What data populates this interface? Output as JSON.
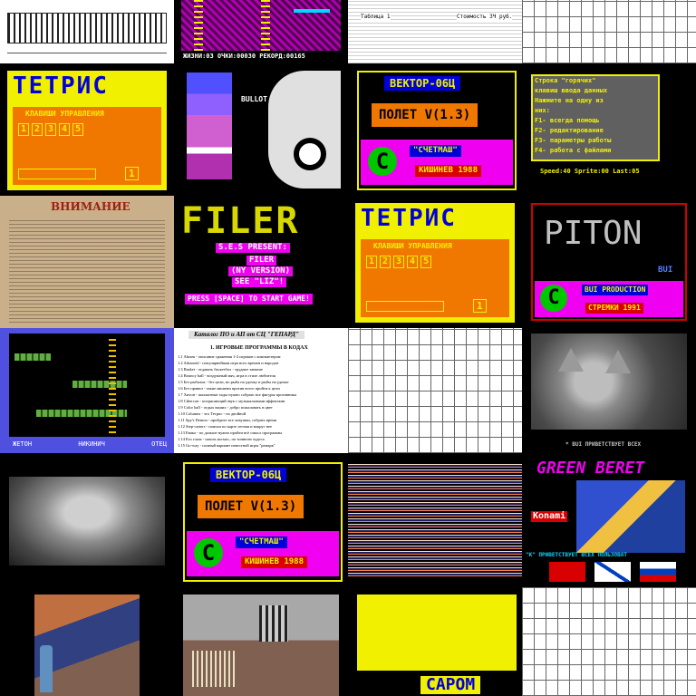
{
  "colors": {
    "black": "#000000",
    "yellow": "#f0f000",
    "orange": "#f07800",
    "blue": "#0000d8",
    "magenta": "#f000f0",
    "green": "#00c800",
    "cyan": "#00d8ff",
    "red": "#d80000"
  },
  "row1": {
    "t2_status": "ЖИЗНИ:03 ОЧКИ:00030 РЕКОРД:00165",
    "t3_heading": "Таблица 1",
    "t3_col": "Стоимость ЗЧ руб."
  },
  "tetris": {
    "title": "ТЕТРИС",
    "subtitle": "КЛАВИШИ УПРАВЛЕНИЯ",
    "keys": [
      "1",
      "2",
      "3",
      "4",
      "5"
    ],
    "center_key": "1"
  },
  "t6_label": "BULLOT",
  "vector": {
    "title": "ВЕКТОР-06Ц",
    "flight": "ПОЛЕТ V(1.3)",
    "logo": "C",
    "company": "\"СЧЕТМАШ\"",
    "city_year": "КИШИНЕВ 1988"
  },
  "t8": {
    "lines": [
      "Строка \"горячих\"",
      "клавиш ввода данных",
      "Нажмите на одну из",
      "них:",
      "F1- всегда помощь",
      "F2- редактирование",
      "F3- параметры работы",
      "F4- работа с файлами"
    ],
    "status": "Speed:40  Sprite:00  Last:05"
  },
  "t9_title": "ВНИМАНИЕ",
  "filer": {
    "title": "FILER",
    "presents": "S.E.S PRESENT:",
    "subtitle": "FILER",
    "version": "(NY VERSION)",
    "see": "SEE \"LIZ\"!",
    "prompt": "PRESS [SPACE] TO START GAME!"
  },
  "piton": {
    "title": "PITON",
    "sub": "BUI",
    "logo": "C",
    "production": "BUI PRODUCTION",
    "city_year": "СТРЕМКИ  1991"
  },
  "t13": {
    "status": [
      "ЖЕТОН",
      "НИКИНИЧ",
      "ОТЕЦ"
    ]
  },
  "catalog": {
    "title": "Каталог ПО и АП от СЦ \"ГЕПАРД\"",
    "section": "1. ИГРОВЫЕ ПРОГРАММЫ В КОДАХ",
    "items": [
      "1.1  Abram - описание сражения 1-2 игроков с компьютером",
      "1.2  Arkanoid - популярнейшая игра всех времен и народов",
      "1.3  Basket - отдавать баскетбол - трудное занятие",
      "1.4  Bouncy ball - воздушный мяч, игра в стиле любителя",
      "1.5  Без рыбалок - без цели, но рыба на удочку и рыбы на удочке",
      "1.6  Без правил - такие мишени против всего пройти к цели",
      "1.7  Хитон - шахматные ходы нужно собрать все фигуры противника",
      "1.8  Cibercon - потрясающий звук с музыкальными эффектами",
      "1.9  Color ball - отдых ваших - добро пожаловать в цвет",
      "1.10 Columns - это Тетрис - но двойной",
      "1.11 Spy's Demon - пройдите все ловушки, собрать время",
      "1.12 Step-carters - поиски по карте лесная и вокруг нее",
      "1.13 Евака - по дальше нужно пройти всё смысл программы",
      "1.14 Его глаза - сквозь космос, по тоннелю чудеса",
      "1.15 Go-way - полный вариант известной игры \"ремарк\""
    ]
  },
  "t16_caption": "* BUI ПРИВЕТСТВУЕТ ВСЕХ",
  "green_beret": {
    "title": "GREEN BERET",
    "brand": "Konami",
    "caption": "\"K\" ПРИВЕТСТВУЕТ ВСЕХ ПОЛЬЗОВАТ"
  },
  "t23_title": "CAPOM"
}
